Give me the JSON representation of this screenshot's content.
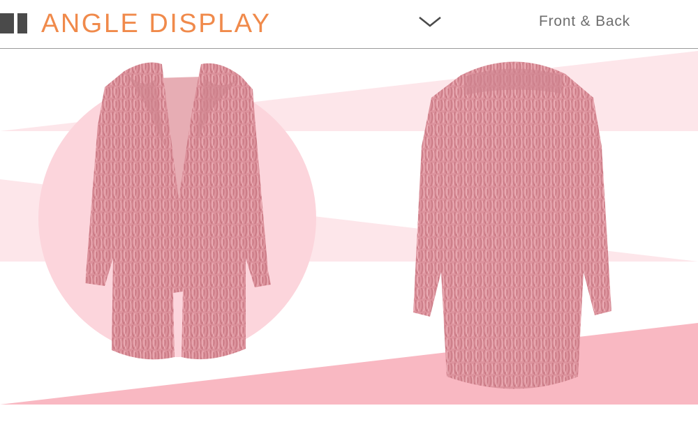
{
  "header": {
    "title": "ANGLE DISPLAY",
    "view_label": "Front & Back"
  },
  "icons": {
    "title_bars": "double-bar-icon",
    "dropdown": "chevron-down-icon"
  },
  "images": {
    "front": "pink faux fur coat, front view",
    "back": "pink faux fur coat, back view"
  },
  "colors": {
    "title": "#f08a4b",
    "accent_pink": "#f9b8c2",
    "light_pink": "#fde6ea",
    "circle_pink": "#fcd5dc",
    "coat_pink": "#d98c97",
    "bars": "#4a4a4a"
  }
}
